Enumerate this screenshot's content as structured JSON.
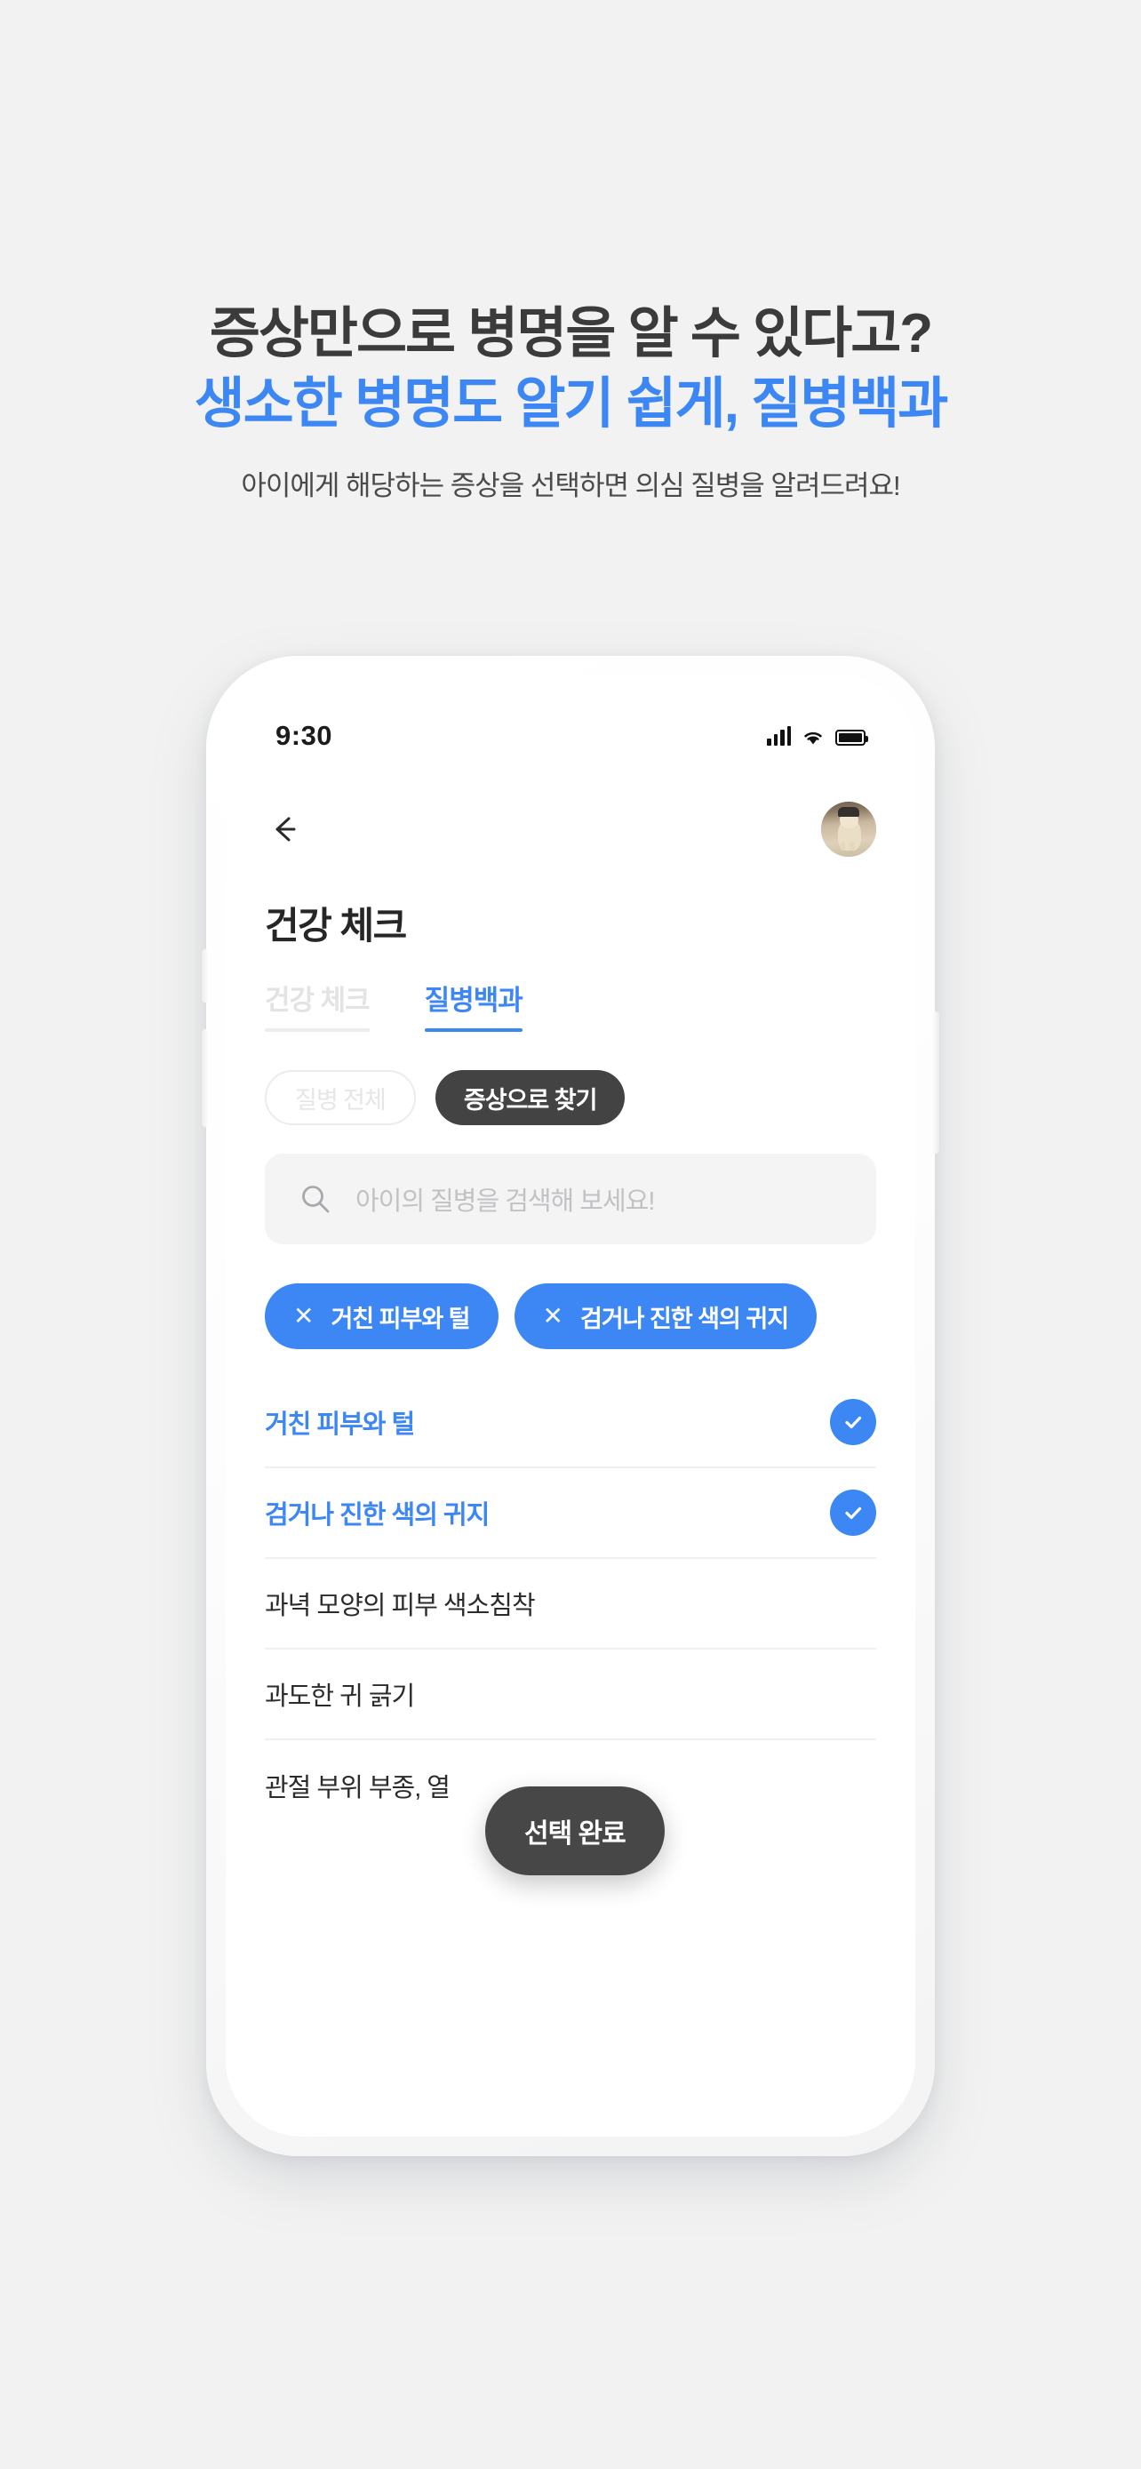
{
  "promo": {
    "headline_line1": "증상만으로 병명을 알 수 있다고?",
    "headline_line2": "생소한 병명도 알기 쉽게, 질병백과",
    "subtitle": "아이에게 해당하는 증상을 선택하면 의심 질병을 알려드려요!",
    "accent_color": "#3d87f5",
    "headline_color": "#3b3b3b"
  },
  "status_bar": {
    "time": "9:30",
    "signal_icon": "cellular-signal-icon",
    "wifi_icon": "wifi-icon",
    "battery_icon": "battery-full-icon"
  },
  "app": {
    "nav": {
      "back_icon": "back-arrow-icon",
      "avatar_alt": "pet-profile-avatar"
    },
    "page_title": "건강 체크",
    "tabs": [
      {
        "label": "건강 체크",
        "active": false
      },
      {
        "label": "질병백과",
        "active": true
      }
    ],
    "filter_chips": [
      {
        "label": "질병 전체",
        "selected": false
      },
      {
        "label": "증상으로 찾기",
        "selected": true
      }
    ],
    "search": {
      "placeholder": "아이의 질병을 검색해 보세요!",
      "value": "",
      "icon": "search-icon"
    },
    "selected_tags": [
      {
        "label": "거친 피부와 털",
        "remove_icon": "close-icon"
      },
      {
        "label": "검거나 진한 색의 귀지",
        "remove_icon": "close-icon"
      }
    ],
    "symptom_list": [
      {
        "label": "거친 피부와 털",
        "selected": true
      },
      {
        "label": "검거나 진한 색의 귀지",
        "selected": true
      },
      {
        "label": "과녁 모양의 피부 색소침착",
        "selected": false
      },
      {
        "label": "과도한 귀 긁기",
        "selected": false
      },
      {
        "label": "관절 부위 부종, 열",
        "selected": false
      }
    ],
    "done_button": {
      "label": "선택 완료"
    },
    "colors": {
      "accent_blue": "#3d87f5",
      "dark_chip": "#434343",
      "fab": "#474747",
      "search_bg": "#f4f4f5",
      "divider": "#f0f0f0"
    }
  }
}
